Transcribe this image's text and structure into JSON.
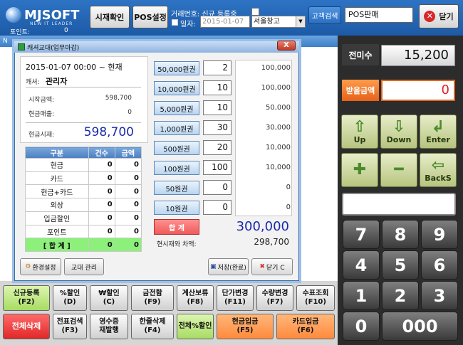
{
  "header": {
    "logo_text": "MJSOFT",
    "logo_sub": "NEW IT LEADER",
    "points_label": "포인트:",
    "points_value": "0",
    "btn_time": "시재확인",
    "btn_pos": "POS설정",
    "tx_label": "거래번호:",
    "tx_value": "신규 등록중",
    "date_label": "일자:",
    "date_value": "2015-01-07",
    "warehouse_value": "서울창고",
    "btn_customer": "고객검색",
    "mode_value": "POS판매",
    "btn_close": "닫기"
  },
  "list_header_letter": "N",
  "right": {
    "unpaid_label": "전미수",
    "unpaid_value": "15,200",
    "received_label": "받을금액",
    "received_value": "0",
    "controls": [
      {
        "label": "Up",
        "glyph": "⇧"
      },
      {
        "label": "Down",
        "glyph": "⇩"
      },
      {
        "label": "Enter",
        "glyph": "↲"
      },
      {
        "label": "",
        "glyph": "✚"
      },
      {
        "label": "",
        "glyph": "━"
      },
      {
        "label": "BackS",
        "glyph": "⇦"
      }
    ],
    "keys": [
      "7",
      "8",
      "9",
      "4",
      "5",
      "6",
      "1",
      "2",
      "3",
      "0",
      "000"
    ]
  },
  "bottom": [
    {
      "label": "신규등록",
      "sub": "(F2)"
    },
    {
      "label": "%할인",
      "sub": "(D)"
    },
    {
      "label": "₩할인",
      "sub": "(C)"
    },
    {
      "label": "금전함",
      "sub": "(F9)"
    },
    {
      "label": "계산보류",
      "sub": "(F8)"
    },
    {
      "label": "단가변경",
      "sub": "(F11)"
    },
    {
      "label": "수량변경",
      "sub": "(F7)"
    },
    {
      "label": "수표조회",
      "sub": "(F10)"
    },
    {
      "label": "전체삭제",
      "sub": ""
    },
    {
      "label": "전표검색",
      "sub": "(F3)"
    },
    {
      "label": "영수증",
      "sub": "재발행"
    },
    {
      "label": "한줄삭제",
      "sub": "(F4)"
    },
    {
      "label": "전체%할인",
      "sub": ""
    },
    {
      "label": "현금입금",
      "sub": "(F5)"
    },
    {
      "label": "카드입금",
      "sub": "(F6)"
    }
  ],
  "dialog": {
    "title": "캐셔교대(업무마감)",
    "close": "X",
    "period": "2015-01-07 00:00 ~ 현재",
    "cashier_label": "캐셔:",
    "cashier_value": "관리자",
    "start_amount_label": "시작금액:",
    "start_amount_value": "598,700",
    "cash_sales_label": "현금매출:",
    "cash_sales_value": "0",
    "cash_on_hand_label": "현금시재:",
    "cash_on_hand_value": "598,700",
    "table_headers": [
      "구분",
      "건수",
      "금액"
    ],
    "table_rows": [
      [
        "현금",
        "0",
        "0"
      ],
      [
        "카드",
        "0",
        "0"
      ],
      [
        "현금+카드",
        "0",
        "0"
      ],
      [
        "외상",
        "0",
        "0"
      ],
      [
        "입금할인",
        "0",
        "0"
      ],
      [
        "포인트",
        "0",
        "0"
      ]
    ],
    "table_total": [
      "[ 합 계 ]",
      "0",
      "0"
    ],
    "denominations": [
      {
        "label": "50,000원권",
        "count": "2",
        "amount": "100,000"
      },
      {
        "label": "10,000원권",
        "count": "10",
        "amount": "100,000"
      },
      {
        "label": "5,000원권",
        "count": "10",
        "amount": "50,000"
      },
      {
        "label": "1,000원권",
        "count": "30",
        "amount": "30,000"
      },
      {
        "label": "500원권",
        "count": "20",
        "amount": "10,000"
      },
      {
        "label": "100원권",
        "count": "100",
        "amount": "10,000"
      },
      {
        "label": "50원권",
        "count": "0",
        "amount": "0"
      },
      {
        "label": "10원권",
        "count": "0",
        "amount": "0"
      }
    ],
    "total_label": "합 계",
    "total_value": "300,000",
    "diff_label": "현시재와 차액:",
    "diff_value": "298,700",
    "btn_env": "환경설정",
    "btn_shift": "교대 관리",
    "btn_save": "저장(완료)",
    "btn_close": "닫기 C"
  }
}
